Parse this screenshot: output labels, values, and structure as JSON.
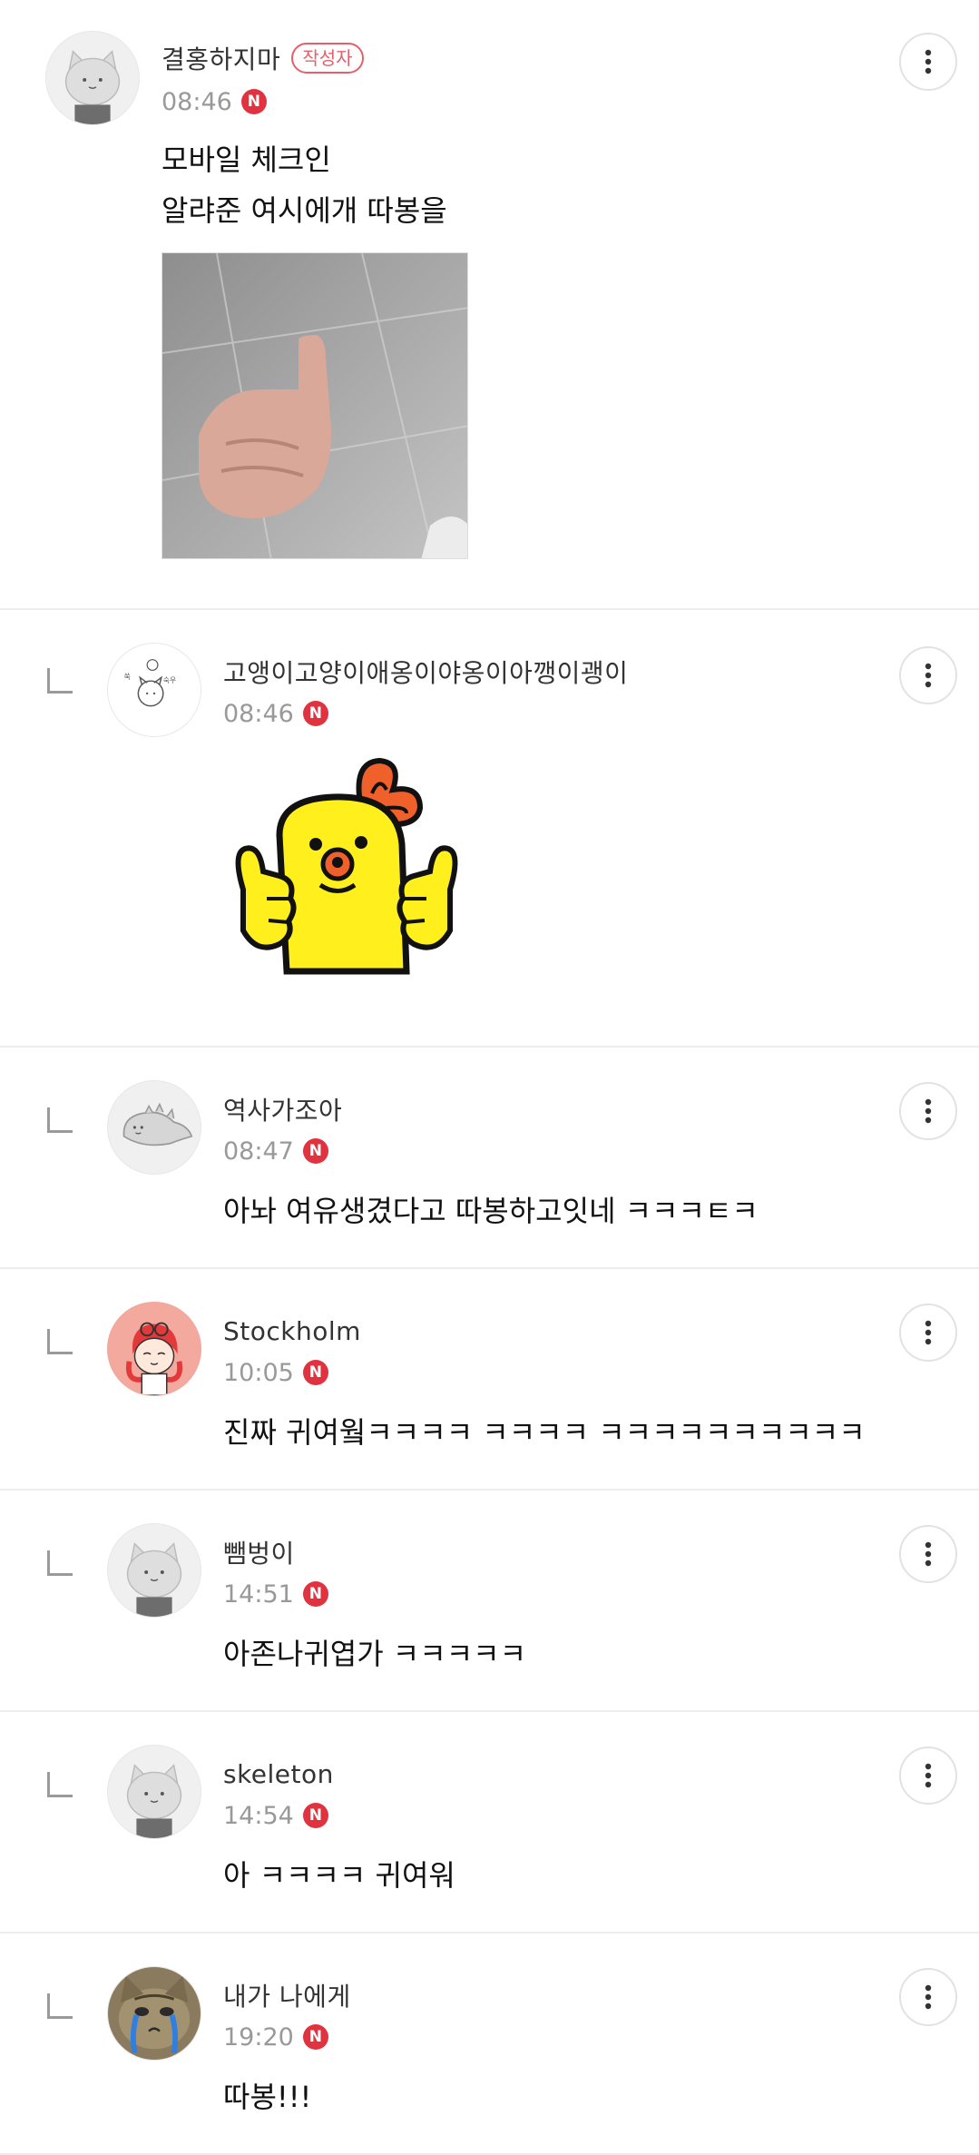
{
  "comments": [
    {
      "author": "결홍하지마",
      "writer_badge": "작성자",
      "time": "08:46",
      "new_badge": "N",
      "text": "모바일 체크인\n알랴준 여시에개 따봉을",
      "avatar_icon": "default-cat-avatar-icon",
      "attachment": "thumbs-up-photo"
    },
    {
      "author": "고앵이고양이애옹이야옹이아깽이괭이",
      "time": "08:46",
      "new_badge": "N",
      "text": "",
      "avatar_icon": "doodle-cat-avatar-icon",
      "attachment": "chick-thumbs-up-sticker"
    },
    {
      "author": "역사가조아",
      "time": "08:47",
      "new_badge": "N",
      "text": "아놔 여유생겼다고 따봉하고잇네 ㅋㅋㅋㅌㅋ",
      "avatar_icon": "dinosaur-avatar-icon"
    },
    {
      "author": "Stockholm",
      "time": "10:05",
      "new_badge": "N",
      "text": "진짜 귀여웤ㅋㅋㅋㅋ ㅋㅋㅋㅋ ㅋㅋㅋㅋㅋㅋㅋㅋㅋㅋ",
      "avatar_icon": "cartoon-girl-avatar-icon"
    },
    {
      "author": "뺌벙이",
      "time": "14:51",
      "new_badge": "N",
      "text": "아존나귀엽가 ㅋㅋㅋㅋㅋ",
      "avatar_icon": "default-cat-avatar-icon"
    },
    {
      "author": "skeleton",
      "time": "14:54",
      "new_badge": "N",
      "text": "아 ㅋㅋㅋㅋ 귀여워",
      "avatar_icon": "default-cat-avatar-icon"
    },
    {
      "author": "내가 나에게",
      "time": "19:20",
      "new_badge": "N",
      "text": "따봉!!!",
      "avatar_icon": "crying-cat-photo-avatar-icon"
    }
  ],
  "colors": {
    "new_badge": "#e0323f",
    "writer_badge": "#e5606b",
    "divider": "#ececec",
    "time": "#999999"
  },
  "icons": {
    "more": "more-vertical-icon",
    "reply": "reply-indent-icon"
  }
}
